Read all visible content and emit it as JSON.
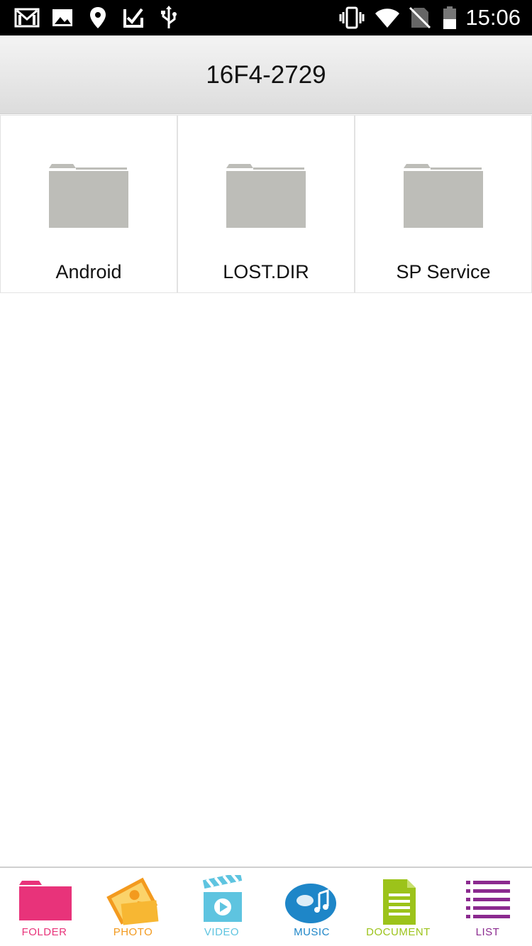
{
  "status_bar": {
    "time": "15:06",
    "icons": [
      "gmail-icon",
      "image-icon",
      "location-icon",
      "check-app-icon",
      "usb-icon",
      "vibrate-icon",
      "wifi-icon",
      "no-sim-icon",
      "battery-icon"
    ]
  },
  "header": {
    "title": "16F4-2729"
  },
  "folders": [
    {
      "label": "Android",
      "icon": "folder-icon"
    },
    {
      "label": "LOST.DIR",
      "icon": "folder-icon"
    },
    {
      "label": "SP Service",
      "icon": "folder-icon"
    }
  ],
  "bottom_nav": {
    "items": [
      {
        "label": "FOLDER",
        "icon": "folder-icon",
        "color": "#e8337a"
      },
      {
        "label": "PHOTO",
        "icon": "photo-icon",
        "color": "#f39a1e"
      },
      {
        "label": "VIDEO",
        "icon": "video-icon",
        "color": "#5ec4e0"
      },
      {
        "label": "MUSIC",
        "icon": "music-icon",
        "color": "#1e86c8"
      },
      {
        "label": "DOCUMENT",
        "icon": "document-icon",
        "color": "#9cc31a"
      },
      {
        "label": "LIST",
        "icon": "list-icon",
        "color": "#8b2a8f"
      }
    ]
  }
}
